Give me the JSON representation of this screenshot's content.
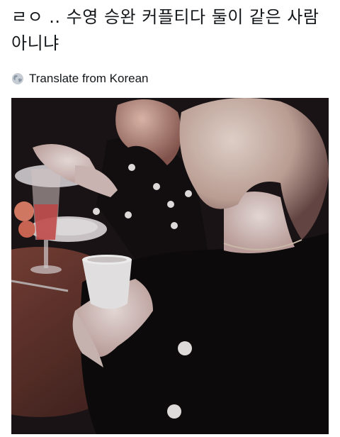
{
  "tweet": {
    "text": "ㄹㅇ .. 수영 승완 커플티다 둘이 같은 사람 아니냐",
    "translate_label": "Translate from Korean"
  },
  "icons": {
    "translate": "globe-icon"
  },
  "colors": {
    "text": "#14171a",
    "background": "#ffffff"
  }
}
